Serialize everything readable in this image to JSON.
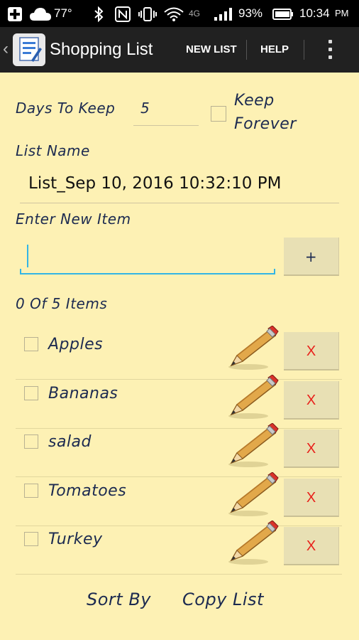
{
  "status_bar": {
    "temperature": "77°",
    "battery_percent": "93%",
    "time": "10:34",
    "time_suffix": "PM",
    "network": "4G"
  },
  "action_bar": {
    "title": "Shopping List",
    "new_list_label": "NEW LIST",
    "help_label": "HELP"
  },
  "form": {
    "days_to_keep_label": "Days To Keep",
    "days_to_keep_value": "5",
    "keep_forever_line1": "Keep",
    "keep_forever_line2": "Forever",
    "list_name_label": "List Name",
    "list_name_value": "List_Sep 10, 2016 10:32:10 PM",
    "enter_item_label": "Enter New Item",
    "new_item_value": "",
    "add_button_label": "+"
  },
  "list": {
    "count_text": "0 Of 5 Items",
    "items": [
      {
        "label": "Apples",
        "checked": false
      },
      {
        "label": "Bananas",
        "checked": false
      },
      {
        "label": "salad",
        "checked": false
      },
      {
        "label": "Tomatoes",
        "checked": false
      },
      {
        "label": "Turkey",
        "checked": false
      }
    ],
    "delete_label": "X"
  },
  "footer": {
    "sort_by_label": "Sort By",
    "copy_list_label": "Copy List"
  },
  "colors": {
    "background": "#fdf1b4",
    "action_bar": "#212121",
    "delete_x": "#e8211b",
    "input_focus": "#33b5e5"
  }
}
